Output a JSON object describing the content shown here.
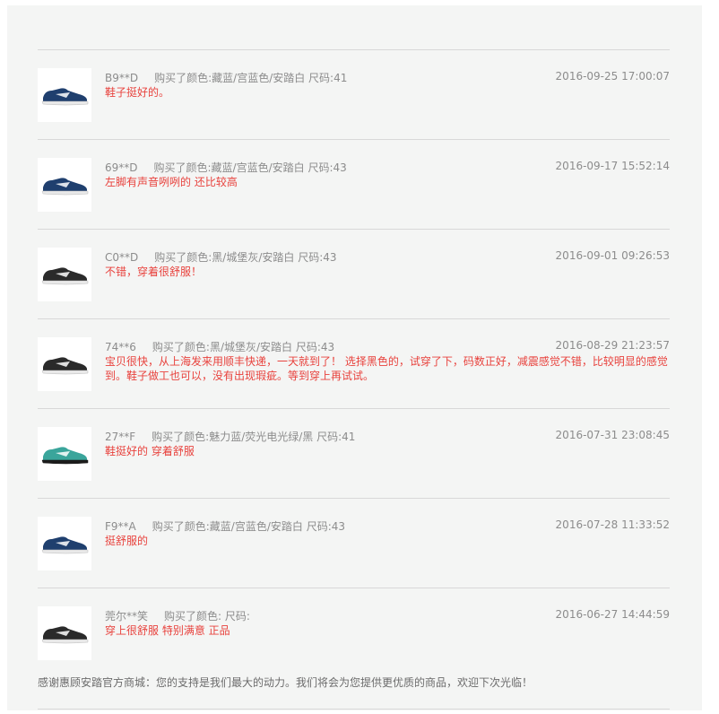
{
  "reviews": [
    {
      "user": "B9**D",
      "spec": "购买了颜色:藏蓝/宫蓝色/安踏白 尺码:41",
      "date": "2016-09-25 17:00:07",
      "comment": "鞋子挺好的。",
      "shoe": "navy"
    },
    {
      "user": "69**D",
      "spec": "购买了颜色:藏蓝/宫蓝色/安踏白 尺码:43",
      "date": "2016-09-17 15:52:14",
      "comment": "左脚有声音咧咧的 还比较高",
      "shoe": "navy"
    },
    {
      "user": "C0**D",
      "spec": "购买了颜色:黑/城堡灰/安踏白 尺码:43",
      "date": "2016-09-01 09:26:53",
      "comment": "不错，穿着很舒服！",
      "shoe": "black"
    },
    {
      "user": "74**6",
      "spec": "购买了颜色:黑/城堡灰/安踏白 尺码:43",
      "date": "2016-08-29 21:23:57",
      "comment": "宝贝很快，从上海发来用顺丰快递，一天就到了！ 选择黑色的，试穿了下，码数正好，减震感觉不错，比较明显的感觉到。鞋子做工也可以，没有出现瑕疵。等到穿上再试试。",
      "shoe": "black"
    },
    {
      "user": "27**F",
      "spec": "购买了颜色:魅力蓝/荧光电光绿/黑 尺码:41",
      "date": "2016-07-31 23:08:45",
      "comment": "鞋挺好的 穿着舒服",
      "shoe": "teal"
    },
    {
      "user": "F9**A",
      "spec": "购买了颜色:藏蓝/宫蓝色/安踏白 尺码:43",
      "date": "2016-07-28 11:33:52",
      "comment": "挺舒服的",
      "shoe": "navy"
    },
    {
      "user": "莞尔**笑",
      "spec": "购买了颜色: 尺码:",
      "date": "2016-06-27 14:44:59",
      "comment": "穿上很舒服 特别满意 正品",
      "shoe": "black"
    }
  ],
  "thanks": "感谢惠顾安踏官方商城：您的支持是我们最大的动力。我们将会为您提供更优质的商品，欢迎下次光临！",
  "colors": {
    "navy": "#1f3f6e",
    "black": "#2a2a2a",
    "teal": "#3aa59b",
    "comment": "#e8423d"
  }
}
